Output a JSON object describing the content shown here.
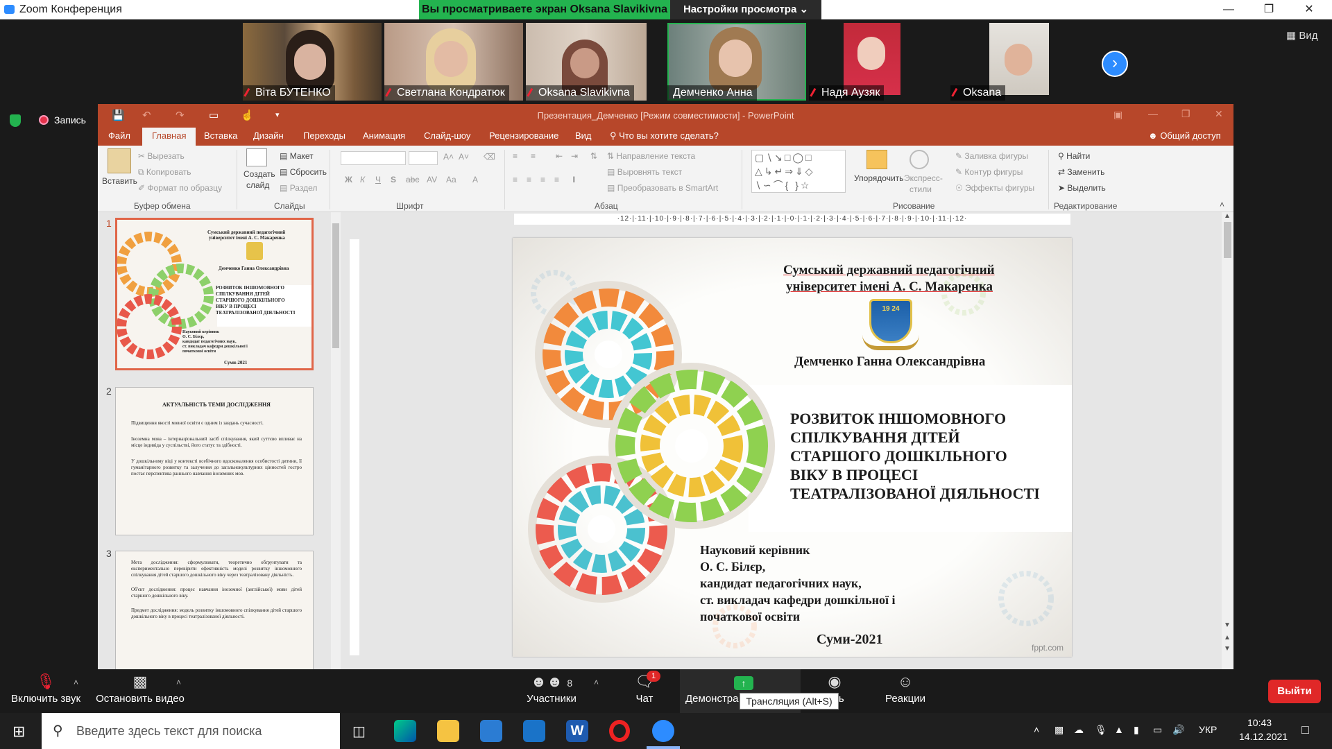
{
  "zoom": {
    "title": "Zoom Конференция",
    "share_banner": "Вы просматриваете экран Oksana Slavikivna",
    "view_options": "Настройки просмотра",
    "recording": "Запись",
    "view_button": "Вид",
    "participants": [
      {
        "name": "Віта БУТЕНКО",
        "muted": true
      },
      {
        "name": "Светлана Кондратюк",
        "muted": true
      },
      {
        "name": "Oksana Slavikivna",
        "muted": true
      },
      {
        "name": "Демченко Анна",
        "muted": false
      },
      {
        "name": "Надя Аузяк",
        "muted": true
      },
      {
        "name": "Oksana",
        "muted": true
      }
    ],
    "controls": {
      "unmute": "Включить звук",
      "stop_video": "Остановить видео",
      "participants": "Участники",
      "participants_count": "8",
      "chat": "Чат",
      "chat_badge": "1",
      "share": "Демонстра",
      "record": "сь",
      "reactions": "Реакции",
      "leave": "Выйти",
      "tooltip": "Трансляция (Alt+S)"
    }
  },
  "ppt": {
    "title": "Презентация_Демченко [Режим совместимости] - PowerPoint",
    "tabs": [
      "Файл",
      "Главная",
      "Вставка",
      "Дизайн",
      "Переходы",
      "Анимация",
      "Слайд-шоу",
      "Рецензирование",
      "Вид"
    ],
    "tell_me": "Что вы хотите сделать?",
    "share": "Общий доступ",
    "ribbon": {
      "paste": "Вставить",
      "cut": "Вырезать",
      "copy": "Копировать",
      "format_painter": "Формат по образцу",
      "clipboard": "Буфер обмена",
      "new_slide_1": "Создать",
      "new_slide_2": "слайд",
      "layout": "Макет",
      "reset": "Сбросить",
      "section": "Раздел",
      "slides": "Слайды",
      "bold": "Ж",
      "italic": "К",
      "underline": "Ч",
      "strike": "S",
      "font": "Шрифт",
      "text_direction": "Направление текста",
      "align_text": "Выровнять текст",
      "smartart": "Преобразовать в SmartArt",
      "paragraph": "Абзац",
      "arrange": "Упорядочить",
      "quick_styles_1": "Экспресс-",
      "quick_styles_2": "стили",
      "shape_fill": "Заливка фигуры",
      "shape_outline": "Контур фигуры",
      "shape_effects": "Эффекты фигуры",
      "drawing": "Рисование",
      "find": "Найти",
      "replace": "Заменить",
      "select": "Выделить",
      "editing": "Редактирование"
    },
    "ruler": "·12·|·11·|·10·|·9·|·8·|·7·|·6·|·5·|·4·|·3·|·2·|·1·|·0·|·1·|·2·|·3·|·4·|·5·|·6·|·7·|·8·|·9·|·10·|·11·|·12·",
    "thumbs": [
      {
        "num": "1",
        "lines": [
          "Сумський державний педагогічний",
          "університет імені А. С. Макаренка",
          "Демченко Ганна Олександрівна",
          "РОЗВИТОК ІНШОМОВНОГО",
          "СПІЛКУВАННЯ ДІТЕЙ",
          "СТАРШОГО ДОШКІЛЬНОГО",
          "ВІКУ В ПРОЦЕСІ",
          "ТЕАТРАЛІЗОВАНОЇ ДІЯЛЬНОСТІ",
          "Науковий керівник",
          "О. С. Білєр,",
          "кандидат педагогічних наук,",
          "ст. викладач кафедри дошкільної і",
          "початкової освіти",
          "Суми-2021"
        ]
      },
      {
        "num": "2",
        "title": "АКТУАЛЬНІСТЬ ТЕМИ ДОСЛІДЖЕННЯ",
        "bullets": [
          "Підвищення якості мовної освіти є одним із завдань сучасності.",
          "Іноземна мова – інтернаціональний засіб спілкування, який суттєво впливає на місце індивіда у суспільстві, його статус та здібності.",
          "У дошкільному віці у контексті всебічного вдосконалення особистості дитини, її гуманітарного розвитку та залучення до загальнокультурних цінностей гостро постає перспектива раннього навчання іноземних мов."
        ]
      },
      {
        "num": "3",
        "bullets": [
          "Мета дослідження: сформулювати, теоретично обґрунтувати та експериментально перевірити ефективність моделі розвитку іншомовного спілкування дітей старшого дошкільного віку через театралізовану діяльність.",
          "Об'єкт дослідження: процес навчання іноземної (англійської) мови дітей старшого дошкільного віку.",
          "Предмет дослідження: модель розвитку іншомовного спілкування дітей старшого дошкільного віку в процесі театралізованої діяльності."
        ]
      }
    ],
    "slide": {
      "university_1": "Сумський державний педагогічний",
      "university_2": "університет імені А. С. Макаренка",
      "emblem_year": "19 24",
      "author": "Демченко Ганна Олександрівна",
      "title": [
        "РОЗВИТОК ІНШОМОВНОГО",
        "СПІЛКУВАННЯ ДІТЕЙ",
        "СТАРШОГО ДОШКІЛЬНОГО",
        "ВІКУ В ПРОЦЕСІ",
        "ТЕАТРАЛІЗОВАНОЇ ДІЯЛЬНОСТІ"
      ],
      "supervisor": [
        "Науковий керівник",
        "О. С. Білєр,",
        "кандидат педагогічних наук,",
        "ст. викладач кафедри дошкільної і",
        "початкової освіти"
      ],
      "city_year": "Суми-2021",
      "watermark": "fppt.com"
    }
  },
  "taskbar": {
    "search_placeholder": "Введите здесь текст для поиска",
    "lang": "УКР",
    "time": "10:43",
    "date": "14.12.2021"
  }
}
